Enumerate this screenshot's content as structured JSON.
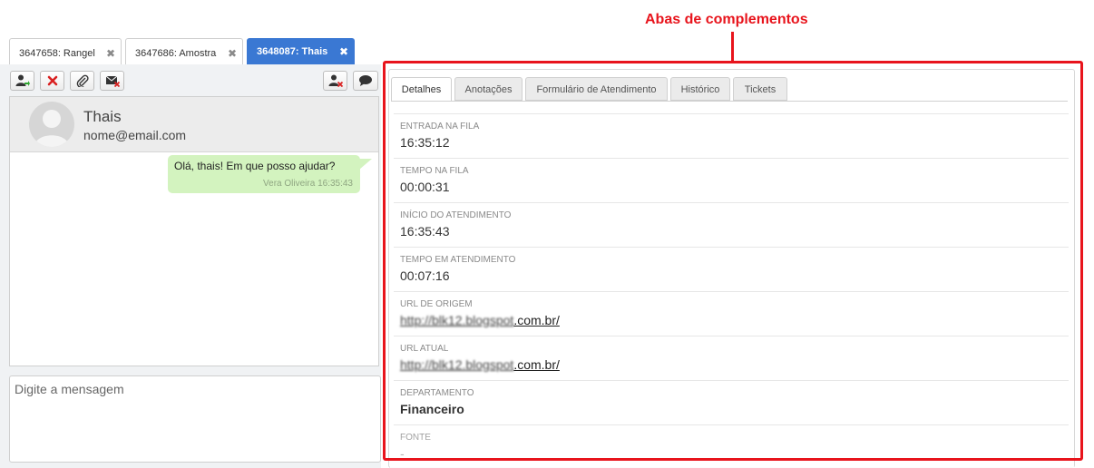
{
  "annotation": {
    "label": "Abas de complementos",
    "color": "#e8141c"
  },
  "conversation_tabs": [
    {
      "label": "3647658: Rangel",
      "close": "✖"
    },
    {
      "label": "3647686: Amostra",
      "close": "✖"
    },
    {
      "label": "3648087: Thais",
      "close": "✖",
      "active": true
    }
  ],
  "toolbar": {
    "icons": [
      "transfer-user-icon",
      "close-x-icon",
      "attachment-icon",
      "mail-block-icon",
      "user-block-icon",
      "chat-bubble-icon"
    ]
  },
  "contact": {
    "name": "Thais",
    "email": "nome@email.com"
  },
  "messages": [
    {
      "text": "Olá, thais! Em que posso ajudar?",
      "meta": "Vera Oliveira 16:35:43"
    }
  ],
  "input": {
    "placeholder": "Digite a mensagem"
  },
  "detail_tabs": [
    {
      "label": "Detalhes",
      "active": true
    },
    {
      "label": "Anotações"
    },
    {
      "label": "Formulário de Atendimento"
    },
    {
      "label": "Histórico"
    },
    {
      "label": "Tickets"
    }
  ],
  "fields": [
    {
      "label": "ENTRADA NA FILA",
      "value": "16:35:12"
    },
    {
      "label": "TEMPO NA FILA",
      "value": "00:00:31"
    },
    {
      "label": "INÍCIO DO ATENDIMENTO",
      "value": "16:35:43"
    },
    {
      "label": "TEMPO EM ATENDIMENTO",
      "value": "00:07:16"
    },
    {
      "label": "URL DE ORIGEM",
      "value_blurred": "http://blk12.blogspot",
      "value_visible": ".com.br/"
    },
    {
      "label": "URL ATUAL",
      "value_blurred": "http://blk12.blogspot",
      "value_visible": ".com.br/"
    },
    {
      "label": "DEPARTAMENTO",
      "value": "Financeiro"
    },
    {
      "label": "FONTE",
      "value": "-"
    }
  ]
}
